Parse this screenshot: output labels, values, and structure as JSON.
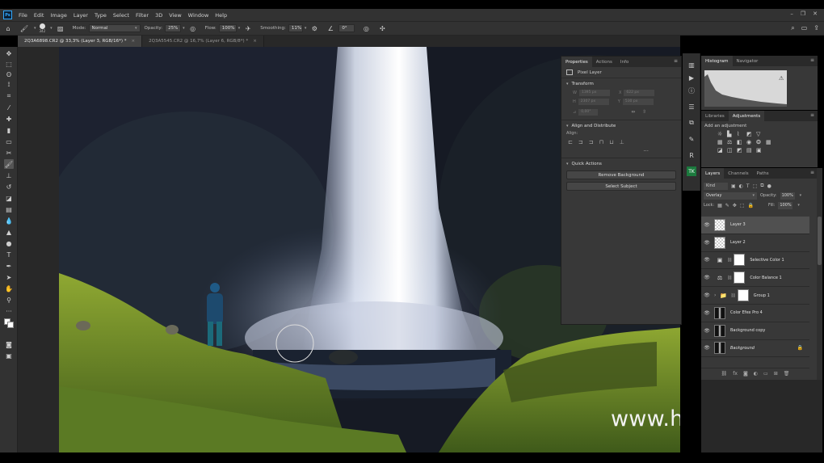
{
  "menu": [
    "File",
    "Edit",
    "Image",
    "Layer",
    "Type",
    "Select",
    "Filter",
    "3D",
    "View",
    "Window",
    "Help"
  ],
  "app_logo": "Ps",
  "options": {
    "brush_size": "342",
    "mode_label": "Mode:",
    "mode_value": "Normal",
    "opacity_label": "Opacity:",
    "opacity_value": "25%",
    "flow_label": "Flow:",
    "flow_value": "100%",
    "smoothing_label": "Smoothing:",
    "smoothing_value": "11%",
    "angle_value": "0°"
  },
  "tabs": [
    {
      "label": "2Q3A6898.CR2 @ 33,3% (Layer 3, RGB/16*) *",
      "active": true
    },
    {
      "label": "2Q3A5545.CR2 @ 16,7% (Layer 6, RGB/8*) *",
      "active": false
    }
  ],
  "properties": {
    "tabs": [
      "Properties",
      "Actions",
      "Info"
    ],
    "layer_type": "Pixel Layer",
    "transform_title": "Transform",
    "w_label": "W",
    "w_value": "1395 px",
    "x_label": "X",
    "x_value": "622 px",
    "h_label": "H",
    "h_value": "2307 px",
    "y_label": "Y",
    "y_value": "530 px",
    "angle_value": "0,00°",
    "align_title": "Align and Distribute",
    "align_label": "Align:",
    "quick_actions_title": "Quick Actions",
    "remove_bg": "Remove Background",
    "select_subject": "Select Subject"
  },
  "histogram": {
    "tabs": [
      "Histogram",
      "Navigator"
    ]
  },
  "adjustments": {
    "tabs": [
      "Libraries",
      "Adjustments"
    ],
    "title": "Add an adjustment"
  },
  "layers_panel": {
    "tabs": [
      "Layers",
      "Channels",
      "Paths"
    ],
    "kind_value": "Kind",
    "blend_mode": "Overlay",
    "opacity_label": "Opacity:",
    "opacity_value": "100%",
    "lock_label": "Lock:",
    "fill_label": "Fill:",
    "fill_value": "100%",
    "layers": [
      {
        "name": "Layer 3",
        "thumb": "checker",
        "selected": true,
        "mask": false
      },
      {
        "name": "Layer 2",
        "thumb": "checker",
        "selected": false,
        "mask": false
      },
      {
        "name": "Selective Color 1",
        "thumb": "adj",
        "icon": "▣",
        "selected": false,
        "mask": true
      },
      {
        "name": "Color Balance 1",
        "thumb": "adj",
        "icon": "⚖",
        "selected": false,
        "mask": true
      },
      {
        "name": "Group 1",
        "thumb": "adj",
        "icon": "📁",
        "selected": false,
        "mask": true
      },
      {
        "name": "Color Efex Pro 4",
        "thumb": "photo",
        "selected": false,
        "mask": false
      },
      {
        "name": "Background copy",
        "thumb": "photo",
        "selected": false,
        "mask": false
      },
      {
        "name": "Background",
        "thumb": "photo",
        "selected": false,
        "mask": false,
        "italic": true,
        "locked": true
      }
    ]
  },
  "watermark": "www.hunls.com",
  "colors": {
    "accent": "#31a8ff",
    "panel_bg": "#383838",
    "chrome_bg": "#323232"
  }
}
